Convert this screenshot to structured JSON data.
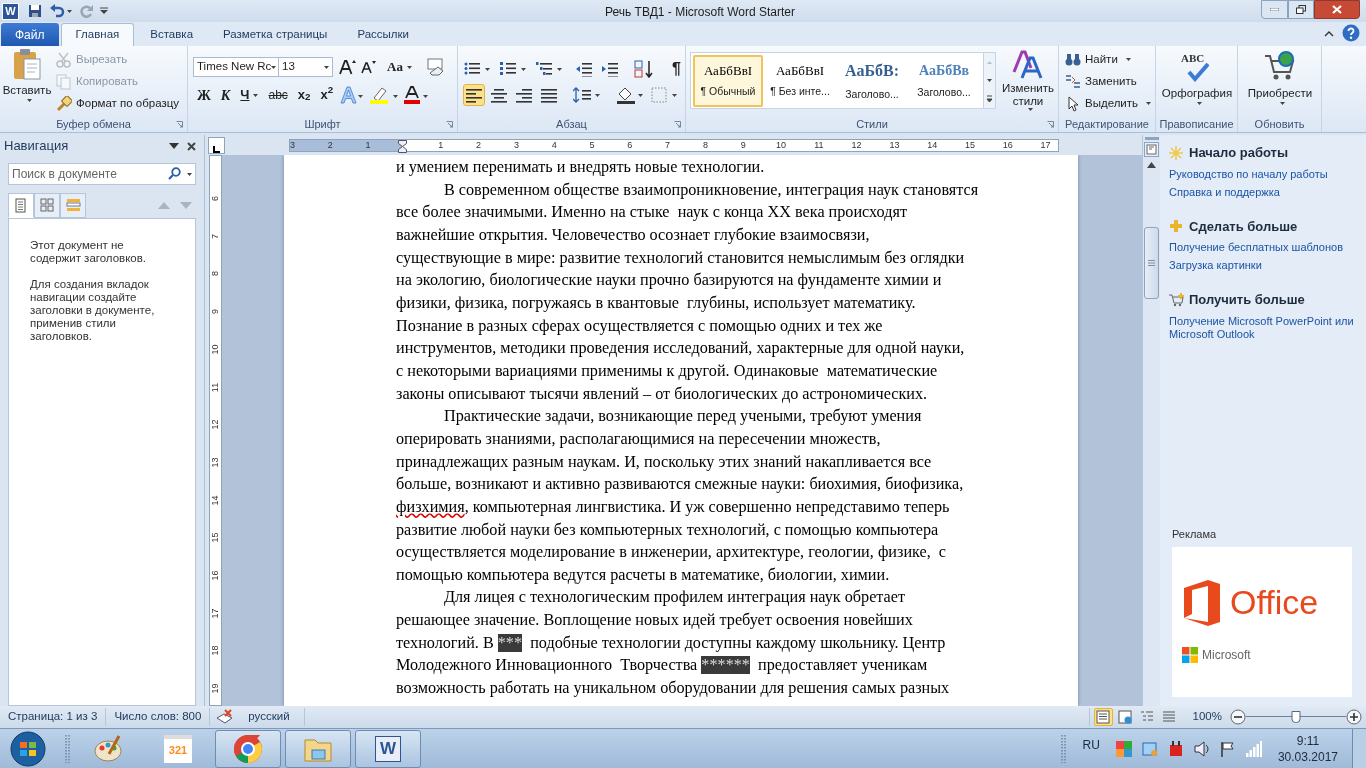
{
  "window": {
    "app_letter": "W",
    "title": "Речь ТВД1  -  Microsoft Word Starter"
  },
  "ribbon_tabs": [
    {
      "label": "Файл",
      "kind": "file",
      "selected": false
    },
    {
      "label": "Главная",
      "kind": "tab",
      "selected": true
    },
    {
      "label": "Вставка",
      "kind": "tab",
      "selected": false
    },
    {
      "label": "Разметка страницы",
      "kind": "tab",
      "selected": false
    },
    {
      "label": "Рассылки",
      "kind": "tab",
      "selected": false
    }
  ],
  "clipboard": {
    "paste": "Вставить",
    "items": [
      {
        "label": "Вырезать",
        "disabled": true
      },
      {
        "label": "Копировать",
        "disabled": true
      },
      {
        "label": "Формат по образцу",
        "disabled": false
      }
    ],
    "label": "Буфер обмена"
  },
  "font": {
    "name": "Times New Rc",
    "size": "13",
    "case_button": "Aa",
    "format_buttons": [
      "Ж",
      "К",
      "Ч",
      "abc",
      "x$_{2}$",
      "x$^{2}$"
    ],
    "label": "Шрифт"
  },
  "paragraph": {
    "pilcrow": "¶",
    "align": [
      {
        "selected": true
      },
      {
        "selected": false
      },
      {
        "selected": false
      },
      {
        "selected": false
      }
    ],
    "label": "Абзац"
  },
  "styles": {
    "items": [
      {
        "sample": "АаБбВвI",
        "name": "¶ Обычный",
        "kind": "normal",
        "selected": true
      },
      {
        "sample": "АаБбВвI",
        "name": "¶ Без инте...",
        "kind": "normal",
        "selected": false
      },
      {
        "sample": "АаБбВ:",
        "name": "Заголово...",
        "kind": "heading1",
        "selected": false
      },
      {
        "sample": "АаБбВв",
        "name": "Заголово...",
        "kind": "heading2",
        "selected": false
      }
    ],
    "change": "Изменить стили",
    "label": "Стили"
  },
  "editing": {
    "items": [
      "Найти",
      "Заменить",
      "Выделить"
    ],
    "label": "Редактирование"
  },
  "proofing": {
    "icon_text": "ABC",
    "button": "Орфография",
    "label": "Правописание"
  },
  "update": {
    "button": "Приобрести",
    "label": "Обновить"
  },
  "navigation": {
    "title": "Навигация",
    "search_placeholder": "Поиск в документе",
    "tabs": [
      {
        "selected": true
      },
      {
        "selected": false
      },
      {
        "selected": false
      }
    ],
    "messages": [
      "Этот документ не содержит заголовков.",
      "Для создания вкладок навигации создайте заголовки в документе, применив стили заголовков."
    ]
  },
  "ruler": {
    "left_numbers": [
      "3",
      "2",
      "1"
    ],
    "numbers": [
      "1",
      "2",
      "3",
      "4",
      "5",
      "6",
      "7",
      "8",
      "9",
      "10",
      "11",
      "12",
      "13",
      "14",
      "15",
      "16",
      "17"
    ],
    "vertical_numbers": [
      "6",
      "7",
      "8",
      "9",
      "10",
      "11",
      "12",
      "13",
      "14",
      "15",
      "16",
      "17",
      "18",
      "19"
    ]
  },
  "document": {
    "paragraphs": [
      {
        "indent": false,
        "lines": [
          "и умением перенимать и внедрять новые технологии."
        ]
      },
      {
        "indent": true,
        "lines": [
          "В современном обществе взаимопроникновение, интеграция наук становятся",
          "все более значимыми. Именно на стыке  наук с конца XX века происходят",
          "важнейшие открытия. Человечество осознает глубокие взаимосвязи,",
          "существующие в мире: развитие технологий становится немыслимым без оглядки",
          "на экологию, биологические науки прочно базируются на фундаменте химии и",
          "физики, физика, погружаясь в квантовые  глубины, использует математику.",
          "Познание в разных сферах осуществляется с помощью одних и тех же",
          "инструментов, методики проведения исследований, характерные для одной науки,",
          "с некоторыми вариациями применимы к другой. Одинаковые  математические",
          "законы описывают тысячи явлений – от биологических до астрономических."
        ]
      },
      {
        "indent": true,
        "lines": [
          "Практические задачи, возникающие перед учеными, требуют умения",
          "оперировать знаниями, располагающимися на пересечении множеств,",
          "принадлежащих разным наукам. И, поскольку этих знаний накапливается все",
          "больше, возникают и активно развиваются смежные науки: биохимия, биофизика,",
          [
            {
              "text": "физхимия",
              "kind": "misspelled"
            },
            {
              "text": ", компьютерная лингвистика. И уж совершенно непредставимо теперь",
              "kind": "plain"
            }
          ],
          "развитие любой науки без компьютерных технологий, с помощью компьютера",
          "осуществляется моделирование в инженерии, архитектуре, геологии, физике,  с",
          "помощью компьютера ведутся расчеты в математике, биологии, химии."
        ]
      },
      {
        "indent": true,
        "lines": [
          "Для лицея с технологическим профилем интеграция наук обретает",
          "решающее значение. Воплощение новых идей требует освоения новейших",
          [
            {
              "text": "технологий. В ",
              "kind": "plain"
            },
            {
              "text": "***",
              "kind": "redacted"
            },
            {
              "text": "  подобные технологии доступны каждому школьнику. Центр",
              "kind": "plain"
            }
          ],
          [
            {
              "text": "Молодежного Инновационного  Творчества ",
              "kind": "plain"
            },
            {
              "text": "******",
              "kind": "redacted"
            },
            {
              "text": "  предоставляет ученикам",
              "kind": "plain"
            }
          ],
          "возможность работать на уникальном оборудовании для решения самых разных"
        ]
      }
    ]
  },
  "side_pane": {
    "sections": [
      {
        "kind": "start",
        "title": "Начало работы",
        "links": [
          "Руководство по началу работы",
          "Справка и поддержка"
        ]
      },
      {
        "kind": "more",
        "title": "Сделать больше",
        "links": [
          "Получение бесплатных шаблонов",
          "Загрузка картинки"
        ]
      },
      {
        "kind": "get",
        "title": "Получить больше",
        "links": [
          "Получение Microsoft PowerPoint или Microsoft Outlook"
        ]
      }
    ],
    "ad_label": "Реклама",
    "ad_product": "Office",
    "ad_brand": "Microsoft"
  },
  "status_bar": {
    "page": "Страница: 1 из 3",
    "words": "Число слов: 800",
    "language": "русский",
    "views": [
      {
        "selected": true
      },
      {
        "selected": false
      },
      {
        "selected": false
      },
      {
        "selected": false
      }
    ],
    "zoom": "100%",
    "zoom_level": {
      "level": 0.5
    }
  },
  "taskbar": {
    "apps": [
      {
        "kind": "paint",
        "running": false
      },
      {
        "kind": "media",
        "running": false,
        "text": "321"
      },
      {
        "kind": "chrome",
        "running": true
      },
      {
        "kind": "explorer",
        "running": true
      },
      {
        "kind": "word",
        "running": true,
        "text": "W"
      }
    ],
    "language": "RU",
    "time": "9:11",
    "date": "30.03.2017"
  }
}
